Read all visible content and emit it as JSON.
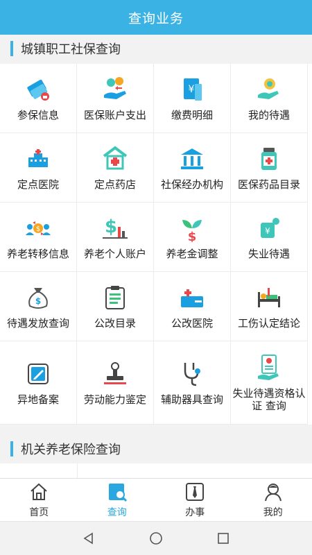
{
  "header": {
    "title": "查询业务"
  },
  "section1": {
    "title": "城镇职工社保查询"
  },
  "section2": {
    "title": "机关养老保险查询"
  },
  "grid": [
    [
      {
        "label": "参保信息",
        "icon": "insurance-card-icon"
      },
      {
        "label": "医保账户支出",
        "icon": "account-expense-icon"
      },
      {
        "label": "缴费明细",
        "icon": "payment-detail-icon"
      },
      {
        "label": "我的待遇",
        "icon": "my-benefits-icon"
      }
    ],
    [
      {
        "label": "定点医院",
        "icon": "hospital-icon"
      },
      {
        "label": "定点药店",
        "icon": "pharmacy-icon"
      },
      {
        "label": "社保经办机构",
        "icon": "institution-icon"
      },
      {
        "label": "医保药品目录",
        "icon": "medicine-bottle-icon"
      }
    ],
    [
      {
        "label": "养老转移信息",
        "icon": "pension-transfer-icon"
      },
      {
        "label": "养老个人账户",
        "icon": "pension-account-icon"
      },
      {
        "label": "养老金调整",
        "icon": "pension-adjust-icon"
      },
      {
        "label": "失业待遇",
        "icon": "unemployment-icon"
      }
    ],
    [
      {
        "label": "待遇发放查询",
        "icon": "money-bag-icon"
      },
      {
        "label": "公改目录",
        "icon": "clipboard-icon"
      },
      {
        "label": "公改医院",
        "icon": "medical-kit-icon"
      },
      {
        "label": "工伤认定结论",
        "icon": "injury-bed-icon"
      }
    ],
    [
      {
        "label": "异地备案",
        "icon": "edit-document-icon"
      },
      {
        "label": "劳动能力鉴定",
        "icon": "stamp-icon"
      },
      {
        "label": "辅助器具查询",
        "icon": "stethoscope-icon"
      },
      {
        "label": "失业待遇资格认证 查询",
        "icon": "certificate-icon"
      }
    ]
  ],
  "tabs": [
    {
      "label": "首页",
      "icon": "home-icon"
    },
    {
      "label": "查询",
      "icon": "search-doc-icon",
      "active": true
    },
    {
      "label": "办事",
      "icon": "tie-icon"
    },
    {
      "label": "我的",
      "icon": "user-icon"
    }
  ],
  "colors": {
    "accent": "#3ab3e4",
    "blue": "#1a9fe0",
    "teal": "#3ec6b8",
    "red": "#e8474c",
    "green": "#3cc17a"
  }
}
